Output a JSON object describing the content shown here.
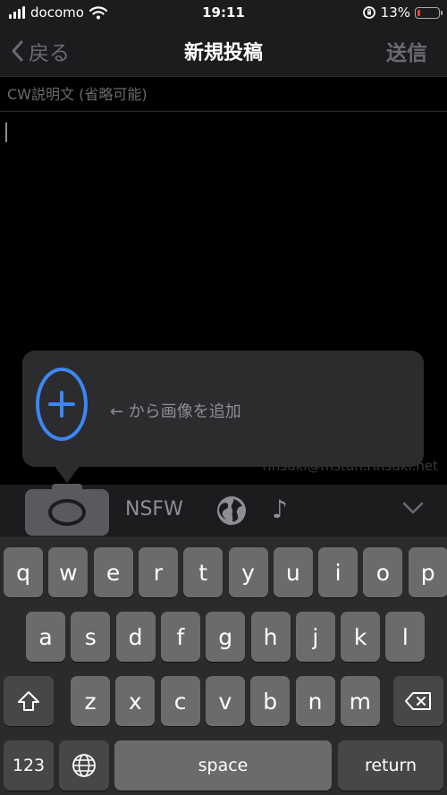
{
  "status": {
    "carrier": "docomo",
    "time": "19:11",
    "battery_text": "13%",
    "battery_level": 0.13,
    "battery_color": "#ff3b30"
  },
  "nav": {
    "back_label": "戻る",
    "title": "新規投稿",
    "send_label": "送信"
  },
  "compose": {
    "cw_placeholder": "CW説明文 (省略可能)",
    "account": "rinsuki@mstdn.rinsuki.net"
  },
  "tooltip": {
    "text": "← から画像を追加",
    "accent": "#3b87f5"
  },
  "toolbar": {
    "camera_icon": "camera-icon",
    "nsfw_label": "NSFW",
    "visibility_icon": "globe-icon",
    "music_icon": "music-note-icon",
    "collapse_icon": "chevron-down-icon"
  },
  "keyboard": {
    "row1": [
      "q",
      "w",
      "e",
      "r",
      "t",
      "y",
      "u",
      "i",
      "o",
      "p"
    ],
    "row2": [
      "a",
      "s",
      "d",
      "f",
      "g",
      "h",
      "j",
      "k",
      "l"
    ],
    "row3": [
      "z",
      "x",
      "c",
      "v",
      "b",
      "n",
      "m"
    ],
    "numbers_label": "123",
    "space_label": "space",
    "return_label": "return"
  }
}
